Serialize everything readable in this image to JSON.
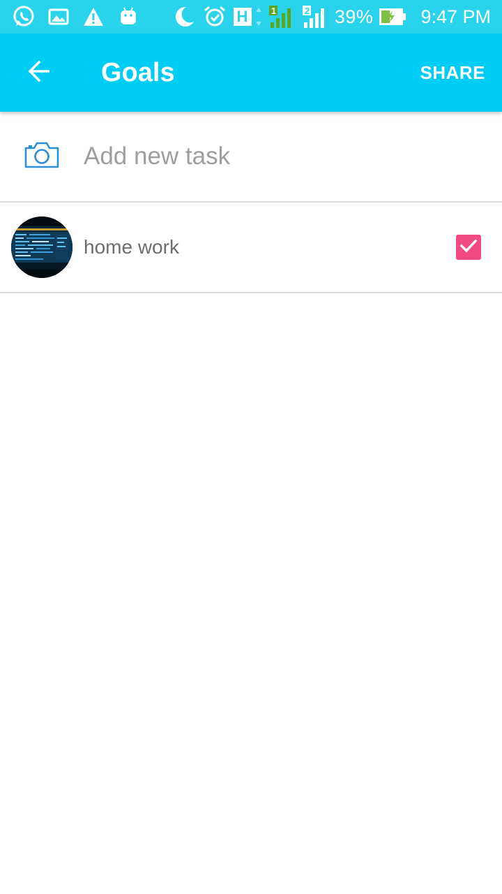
{
  "status_bar": {
    "battery_percent": "39%",
    "time": "9:47 PM",
    "sim1_label": "1",
    "sim2_label": "2",
    "network_type": "H",
    "left_icons": [
      "whatsapp-icon",
      "gallery-icon",
      "warning-icon",
      "android-icon"
    ],
    "right_icons": [
      "moon-icon",
      "alarm-icon",
      "signal-icon",
      "battery-charging-icon"
    ]
  },
  "app_bar": {
    "title": "Goals",
    "share_label": "SHARE",
    "back_icon": "arrow-back-icon",
    "background_color": "#00cdf6"
  },
  "add_task": {
    "placeholder": "Add new task",
    "value": "",
    "icon": "camera-icon"
  },
  "tasks": [
    {
      "label": "home work",
      "checked": true,
      "thumbnail": "code-screen-image"
    }
  ],
  "colors": {
    "status_bar": "#2ad3ec",
    "accent": "#00cdf6",
    "checkbox": "#f04a80",
    "camera_icon": "#2a8fd8"
  }
}
